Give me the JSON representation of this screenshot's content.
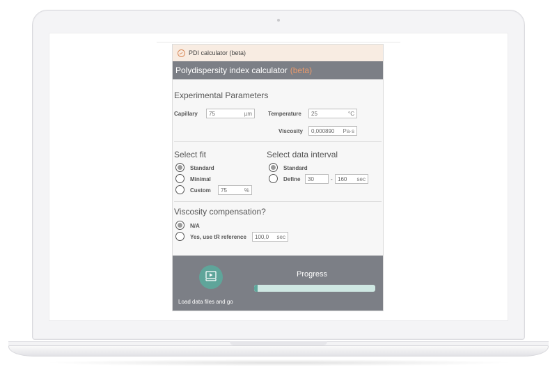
{
  "app": {
    "title": "PDI calculator (beta)",
    "header_title": "Polydispersity index calculator",
    "header_badge": "(beta)",
    "accent": "#e99a6c",
    "header_bg": "#7c7f86"
  },
  "experimental": {
    "title": "Experimental Parameters",
    "capillary_label": "Capillary",
    "capillary_value": "75",
    "capillary_unit": "µm",
    "temperature_label": "Temperature",
    "temperature_value": "25",
    "temperature_unit": "°C",
    "viscosity_label": "Viscosity",
    "viscosity_value": "0,000890",
    "viscosity_unit": "Pa·s"
  },
  "fit": {
    "title": "Select fit",
    "options": [
      {
        "label": "Standard",
        "selected": true
      },
      {
        "label": "Minimal",
        "selected": false
      },
      {
        "label": "Custom",
        "selected": false
      }
    ],
    "custom_value": "75",
    "custom_unit": "%"
  },
  "interval": {
    "title": "Select data interval",
    "options": [
      {
        "label": "Standard",
        "selected": true
      },
      {
        "label": "Define",
        "selected": false
      }
    ],
    "from": "30",
    "separator": "-",
    "to": "160",
    "unit": "sec"
  },
  "viscosity_comp": {
    "title": "Viscosity compensation?",
    "options": [
      {
        "label": "N/A",
        "selected": true
      },
      {
        "label": "Yes, use tR reference",
        "selected": false
      }
    ],
    "reference_value": "100,0",
    "reference_unit": "sec"
  },
  "footer": {
    "go_label": "Load data files and go",
    "progress_title": "Progress",
    "progress_fraction": 0.03,
    "go_color": "#5fa59a"
  },
  "icons": [
    "pdi-logo-icon",
    "load-and-go-icon"
  ]
}
